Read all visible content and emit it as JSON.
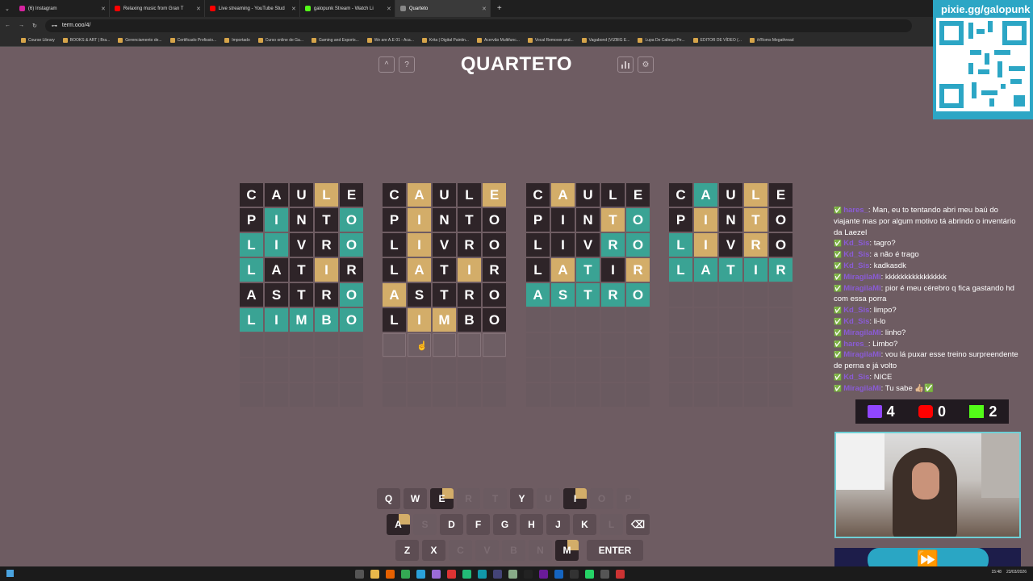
{
  "browser": {
    "tabs": [
      {
        "label": "(6) Instagram",
        "color": "#d6249f",
        "active": false
      },
      {
        "label": "Relaxing music from Gran T",
        "color": "#ff0000",
        "active": false
      },
      {
        "label": "Live streaming - YouTube Stud",
        "color": "#ff0000",
        "active": false
      },
      {
        "label": "galopunk Stream - Watch Li",
        "color": "#53fc18",
        "active": false
      },
      {
        "label": "Quarteto",
        "color": "#888888",
        "active": true
      }
    ],
    "url": "term.ooo/4/",
    "bookmarks": [
      "Course Library",
      "BOOKS & ART | Bra...",
      "Gerenciamento de...",
      "Certificado Profissio...",
      "Importado",
      "Curso online de Ga...",
      "Gaming and Esports...",
      "We are A.E 01 - Aca...",
      "Krita | Digital Paintin...",
      "Acervão Multifunc...",
      "Vocal Remover and...",
      "Vagabond (VIZBIG E...",
      "Lupa De Cabeça Pe...",
      "EDITOR DE VÍDEO (...",
      "/r/Roms Megathread"
    ]
  },
  "game": {
    "title": "QUARTETO",
    "icons": [
      "chevron-up-icon",
      "help-icon",
      "stats-icon",
      "gear-icon"
    ],
    "boards": [
      [
        [
          [
            "C",
            "b"
          ],
          [
            "A",
            "b"
          ],
          [
            "U",
            "b"
          ],
          [
            "L",
            "y"
          ],
          [
            "E",
            "b"
          ]
        ],
        [
          [
            "P",
            "b"
          ],
          [
            "I",
            "g"
          ],
          [
            "N",
            "b"
          ],
          [
            "T",
            "b"
          ],
          [
            "O",
            "g"
          ]
        ],
        [
          [
            "L",
            "g"
          ],
          [
            "I",
            "g"
          ],
          [
            "V",
            "b"
          ],
          [
            "R",
            "b"
          ],
          [
            "O",
            "g"
          ]
        ],
        [
          [
            "L",
            "g"
          ],
          [
            "A",
            "b"
          ],
          [
            "T",
            "b"
          ],
          [
            "I",
            "y"
          ],
          [
            "R",
            "b"
          ]
        ],
        [
          [
            "A",
            "b"
          ],
          [
            "S",
            "b"
          ],
          [
            "T",
            "b"
          ],
          [
            "R",
            "b"
          ],
          [
            "O",
            "g"
          ]
        ],
        [
          [
            "L",
            "g"
          ],
          [
            "I",
            "g"
          ],
          [
            "M",
            "g"
          ],
          [
            "B",
            "g"
          ],
          [
            "O",
            "g"
          ]
        ],
        [
          [
            "",
            "e"
          ],
          [
            "",
            "e"
          ],
          [
            "",
            "e"
          ],
          [
            "",
            "e"
          ],
          [
            "",
            "e"
          ]
        ],
        [
          [
            "",
            "e"
          ],
          [
            "",
            "e"
          ],
          [
            "",
            "e"
          ],
          [
            "",
            "e"
          ],
          [
            "",
            "e"
          ]
        ],
        [
          [
            "",
            "e"
          ],
          [
            "",
            "e"
          ],
          [
            "",
            "e"
          ],
          [
            "",
            "e"
          ],
          [
            "",
            "e"
          ]
        ]
      ],
      [
        [
          [
            "C",
            "b"
          ],
          [
            "A",
            "y"
          ],
          [
            "U",
            "b"
          ],
          [
            "L",
            "b"
          ],
          [
            "E",
            "y"
          ]
        ],
        [
          [
            "P",
            "b"
          ],
          [
            "I",
            "y"
          ],
          [
            "N",
            "b"
          ],
          [
            "T",
            "b"
          ],
          [
            "O",
            "b"
          ]
        ],
        [
          [
            "L",
            "b"
          ],
          [
            "I",
            "y"
          ],
          [
            "V",
            "b"
          ],
          [
            "R",
            "b"
          ],
          [
            "O",
            "b"
          ]
        ],
        [
          [
            "L",
            "b"
          ],
          [
            "A",
            "y"
          ],
          [
            "T",
            "b"
          ],
          [
            "I",
            "y"
          ],
          [
            "R",
            "b"
          ]
        ],
        [
          [
            "A",
            "y"
          ],
          [
            "S",
            "b"
          ],
          [
            "T",
            "b"
          ],
          [
            "R",
            "b"
          ],
          [
            "O",
            "b"
          ]
        ],
        [
          [
            "L",
            "b"
          ],
          [
            "I",
            "y"
          ],
          [
            "M",
            "y"
          ],
          [
            "B",
            "b"
          ],
          [
            "O",
            "b"
          ]
        ],
        [
          [
            "",
            "cur"
          ],
          [
            "",
            "cur"
          ],
          [
            "",
            "cur"
          ],
          [
            "",
            "cur"
          ],
          [
            "",
            "cur"
          ]
        ],
        [
          [
            "",
            "e"
          ],
          [
            "",
            "e"
          ],
          [
            "",
            "e"
          ],
          [
            "",
            "e"
          ],
          [
            "",
            "e"
          ]
        ],
        [
          [
            "",
            "e"
          ],
          [
            "",
            "e"
          ],
          [
            "",
            "e"
          ],
          [
            "",
            "e"
          ],
          [
            "",
            "e"
          ]
        ]
      ],
      [
        [
          [
            "C",
            "b"
          ],
          [
            "A",
            "y"
          ],
          [
            "U",
            "b"
          ],
          [
            "L",
            "b"
          ],
          [
            "E",
            "b"
          ]
        ],
        [
          [
            "P",
            "b"
          ],
          [
            "I",
            "b"
          ],
          [
            "N",
            "b"
          ],
          [
            "T",
            "y"
          ],
          [
            "O",
            "g"
          ]
        ],
        [
          [
            "L",
            "b"
          ],
          [
            "I",
            "b"
          ],
          [
            "V",
            "b"
          ],
          [
            "R",
            "g"
          ],
          [
            "O",
            "g"
          ]
        ],
        [
          [
            "L",
            "b"
          ],
          [
            "A",
            "y"
          ],
          [
            "T",
            "g"
          ],
          [
            "I",
            "b"
          ],
          [
            "R",
            "y"
          ]
        ],
        [
          [
            "A",
            "g"
          ],
          [
            "S",
            "g"
          ],
          [
            "T",
            "g"
          ],
          [
            "R",
            "g"
          ],
          [
            "O",
            "g"
          ]
        ],
        [
          [
            "",
            "e"
          ],
          [
            "",
            "e"
          ],
          [
            "",
            "e"
          ],
          [
            "",
            "e"
          ],
          [
            "",
            "e"
          ]
        ],
        [
          [
            "",
            "e"
          ],
          [
            "",
            "e"
          ],
          [
            "",
            "e"
          ],
          [
            "",
            "e"
          ],
          [
            "",
            "e"
          ]
        ],
        [
          [
            "",
            "e"
          ],
          [
            "",
            "e"
          ],
          [
            "",
            "e"
          ],
          [
            "",
            "e"
          ],
          [
            "",
            "e"
          ]
        ],
        [
          [
            "",
            "e"
          ],
          [
            "",
            "e"
          ],
          [
            "",
            "e"
          ],
          [
            "",
            "e"
          ],
          [
            "",
            "e"
          ]
        ]
      ],
      [
        [
          [
            "C",
            "b"
          ],
          [
            "A",
            "g"
          ],
          [
            "U",
            "b"
          ],
          [
            "L",
            "y"
          ],
          [
            "E",
            "b"
          ]
        ],
        [
          [
            "P",
            "b"
          ],
          [
            "I",
            "y"
          ],
          [
            "N",
            "b"
          ],
          [
            "T",
            "y"
          ],
          [
            "O",
            "b"
          ]
        ],
        [
          [
            "L",
            "g"
          ],
          [
            "I",
            "y"
          ],
          [
            "V",
            "b"
          ],
          [
            "R",
            "y"
          ],
          [
            "O",
            "b"
          ]
        ],
        [
          [
            "L",
            "g"
          ],
          [
            "A",
            "g"
          ],
          [
            "T",
            "g"
          ],
          [
            "I",
            "g"
          ],
          [
            "R",
            "g"
          ]
        ],
        [
          [
            "",
            "e"
          ],
          [
            "",
            "e"
          ],
          [
            "",
            "e"
          ],
          [
            "",
            "e"
          ],
          [
            "",
            "e"
          ]
        ],
        [
          [
            "",
            "e"
          ],
          [
            "",
            "e"
          ],
          [
            "",
            "e"
          ],
          [
            "",
            "e"
          ],
          [
            "",
            "e"
          ]
        ],
        [
          [
            "",
            "e"
          ],
          [
            "",
            "e"
          ],
          [
            "",
            "e"
          ],
          [
            "",
            "e"
          ],
          [
            "",
            "e"
          ]
        ],
        [
          [
            "",
            "e"
          ],
          [
            "",
            "e"
          ],
          [
            "",
            "e"
          ],
          [
            "",
            "e"
          ],
          [
            "",
            "e"
          ]
        ],
        [
          [
            "",
            "e"
          ],
          [
            "",
            "e"
          ],
          [
            "",
            "e"
          ],
          [
            "",
            "e"
          ],
          [
            "",
            "e"
          ]
        ]
      ]
    ],
    "keyboard": [
      [
        [
          "Q",
          "u"
        ],
        [
          "W",
          "u"
        ],
        [
          "E",
          "kq"
        ],
        [
          "R",
          "d"
        ],
        [
          "T",
          "d"
        ],
        [
          "Y",
          "u"
        ],
        [
          "U",
          "d"
        ],
        [
          "I",
          "kq"
        ],
        [
          "O",
          "d"
        ],
        [
          "P",
          "d"
        ]
      ],
      [
        [
          "A",
          "kq"
        ],
        [
          "S",
          "d"
        ],
        [
          "D",
          "u"
        ],
        [
          "F",
          "u"
        ],
        [
          "G",
          "u"
        ],
        [
          "H",
          "u"
        ],
        [
          "J",
          "u"
        ],
        [
          "K",
          "u"
        ],
        [
          "L",
          "d"
        ],
        [
          "⌫",
          "u"
        ]
      ],
      [
        [
          "Z",
          "u"
        ],
        [
          "X",
          "u"
        ],
        [
          "C",
          "d"
        ],
        [
          "V",
          "d"
        ],
        [
          "B",
          "d"
        ],
        [
          "N",
          "d"
        ],
        [
          "M",
          "kq"
        ],
        [
          "ENTER",
          "u"
        ]
      ]
    ],
    "colors": {
      "green": "#3aa394",
      "yellow": "#d3ad69",
      "absent": "#2e2428",
      "background": "#6e5c62"
    }
  },
  "overlay": {
    "pix_title": "pixie.gg/galopunk",
    "chat": [
      {
        "user": "hares_",
        "text": "Man, eu to tentando abri meu baú do viajante mas por algum motivo tá abrindo o inventário da Laezel"
      },
      {
        "user": "Kd_Sis",
        "text": "tagro?"
      },
      {
        "user": "Kd_Sis",
        "text": "a não é trago"
      },
      {
        "user": "Kd_Sis",
        "text": "kadkasdk"
      },
      {
        "user": "MiragilaMi",
        "text": "kkkkkkkkkkkkkkkk"
      },
      {
        "user": "MiragilaMi",
        "text": "pior é meu cérebro q fica gastando hd com essa porra"
      },
      {
        "user": "Kd_Sis",
        "text": "limpo?"
      },
      {
        "user": "Kd_Sis",
        "text": "li-lo"
      },
      {
        "user": "MiragilaMi",
        "text": "linho?"
      },
      {
        "user": "hares_",
        "text": "Limbo?"
      },
      {
        "user": "MiragilaMi",
        "text": "vou lá puxar esse treino surpreendente de perna e já volto"
      },
      {
        "user": "Kd_Sis",
        "text": "NICE"
      },
      {
        "user": "MiragilaMi",
        "text": "Tu sabe 👍🏼✅"
      }
    ],
    "scores": {
      "twitch": "4",
      "youtube": "0",
      "kick": "2"
    }
  },
  "taskbar": {
    "time": "15:48",
    "date": "23/03/2026"
  }
}
